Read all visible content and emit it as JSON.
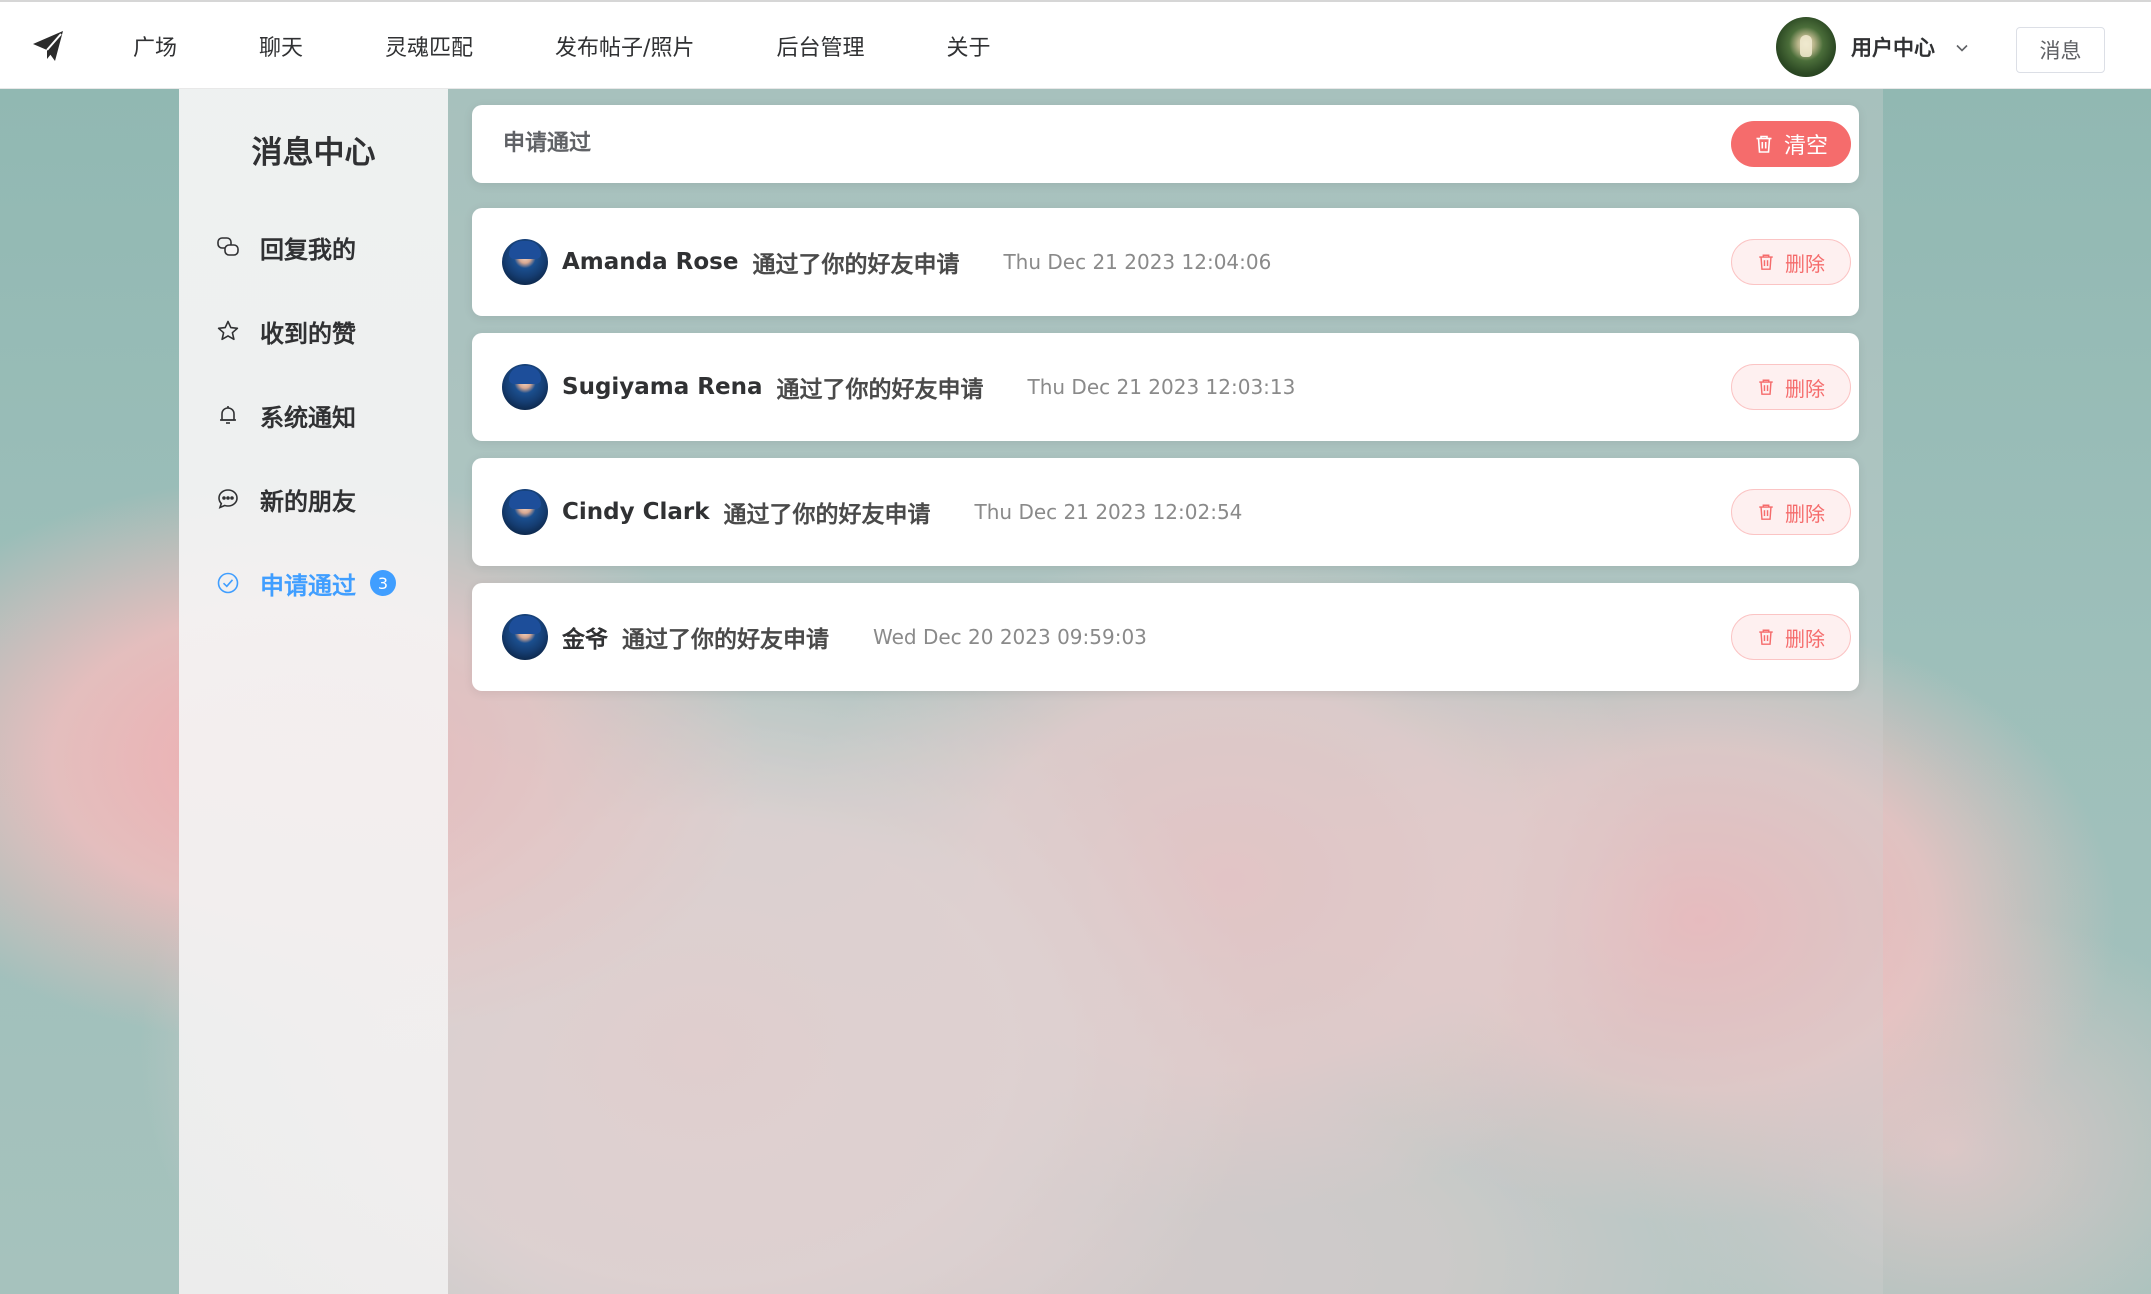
{
  "nav": {
    "logo_icon": "paper-plane-icon",
    "items": [
      "广场",
      "聊天",
      "灵魂匹配",
      "发布帖子/照片",
      "后台管理",
      "关于"
    ],
    "user_label": "用户中心",
    "message_button": "消息"
  },
  "sidebar": {
    "title": "消息中心",
    "items": [
      {
        "label": "回复我的",
        "icon": "chat-bubbles-icon",
        "active": false
      },
      {
        "label": "收到的赞",
        "icon": "star-icon",
        "active": false
      },
      {
        "label": "系统通知",
        "icon": "bell-icon",
        "active": false
      },
      {
        "label": "新的朋友",
        "icon": "chat-dots-icon",
        "active": false
      },
      {
        "label": "申请通过",
        "icon": "circle-check-icon",
        "active": true,
        "badge": "3"
      }
    ]
  },
  "main": {
    "header_title": "申请通过",
    "clear_label": "清空",
    "delete_label": "删除",
    "messages": [
      {
        "user": "Amanda Rose",
        "text": "通过了你的好友申请",
        "time": "Thu Dec 21 2023 12:04:06"
      },
      {
        "user": "Sugiyama Rena",
        "text": "通过了你的好友申请",
        "time": "Thu Dec 21 2023 12:03:13"
      },
      {
        "user": "Cindy Clark",
        "text": "通过了你的好友申请",
        "time": "Thu Dec 21 2023 12:02:54"
      },
      {
        "user": "金爷",
        "text": "通过了你的好友申请",
        "time": "Wed Dec 20 2023 09:59:03"
      }
    ]
  },
  "colors": {
    "accent": "#409eff",
    "danger": "#f56c6c",
    "danger_light": "#fef0f0"
  }
}
